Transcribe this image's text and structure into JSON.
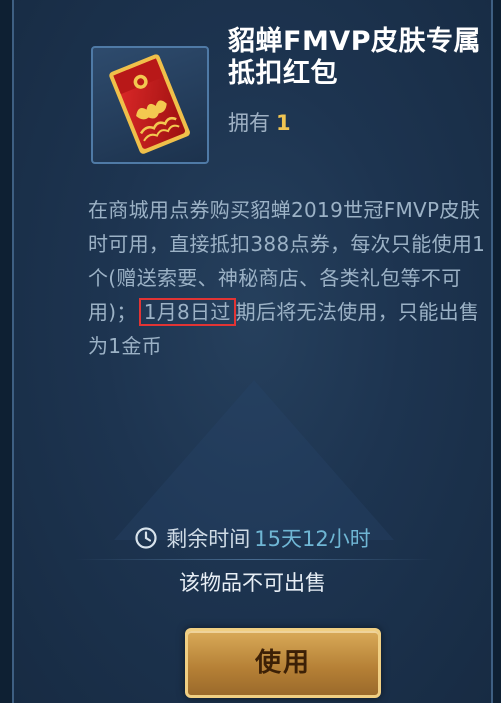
{
  "item": {
    "title": "貂蝉FMVP皮肤专属抵扣红包",
    "owned_label": "拥有",
    "owned_count": "1",
    "icon": "red-envelope-icon"
  },
  "description": {
    "text_before": "在商城用点券购买貂蝉2019世冠FMVP皮肤时可用，直接抵扣388点券，每次只能使用1个(赠送索要、神秘商店、各类礼包等不可用)；",
    "highlight": "1月8日过",
    "text_after": "期后将无法使用，只能出售为1金币"
  },
  "timer": {
    "label": "剩余时间",
    "value": "15天12小时",
    "icon": "clock-icon"
  },
  "sell_status": "该物品不可出售",
  "use_button": "使用",
  "colors": {
    "panel": "#1d3450",
    "highlight_border": "#e23434",
    "timer_value": "#6fb6d4",
    "owned_count": "#f0c552",
    "button_gold": "#d9aa58"
  }
}
